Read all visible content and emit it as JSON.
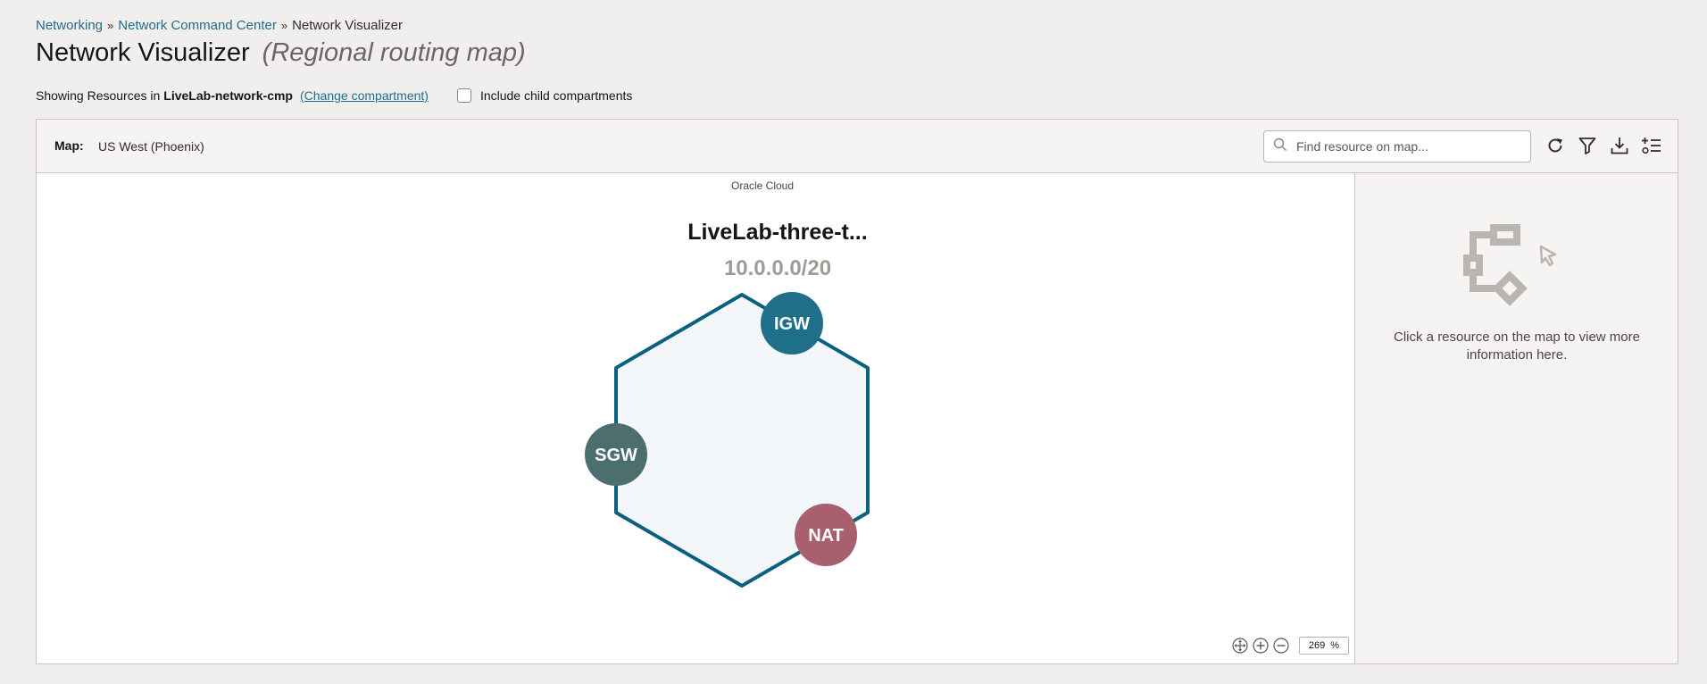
{
  "breadcrumb": {
    "items": [
      "Networking",
      "Network Command Center"
    ],
    "current": "Network Visualizer",
    "separator": "»"
  },
  "page": {
    "title": "Network Visualizer",
    "subtitle": "(Regional routing map)"
  },
  "compartment": {
    "prefix": "Showing Resources in",
    "name": "LiveLab-network-cmp",
    "change_link": "(Change compartment)",
    "include_children_label": "Include child compartments",
    "include_children_checked": false
  },
  "toolbar": {
    "map_label": "Map:",
    "map_region": "US West (Phoenix)",
    "search_placeholder": "Find resource on map...",
    "icons": [
      "refresh-icon",
      "filter-icon",
      "download-icon",
      "legend-icon"
    ]
  },
  "map": {
    "cloud_label": "Oracle Cloud",
    "vcn": {
      "name": "LiveLab-three-t...",
      "cidr": "10.0.0.0/20",
      "border_color": "#0b5f80",
      "fill_color": "#f4f7fa"
    },
    "gateways": [
      {
        "label": "IGW",
        "color": "#1f6e8a"
      },
      {
        "label": "SGW",
        "color": "#4d6e6e"
      },
      {
        "label": "NAT",
        "color": "#a85f6e"
      }
    ],
    "zoom": {
      "value": "269",
      "unit": "%"
    }
  },
  "side_panel": {
    "message": "Click a resource on the map to view more information here."
  }
}
